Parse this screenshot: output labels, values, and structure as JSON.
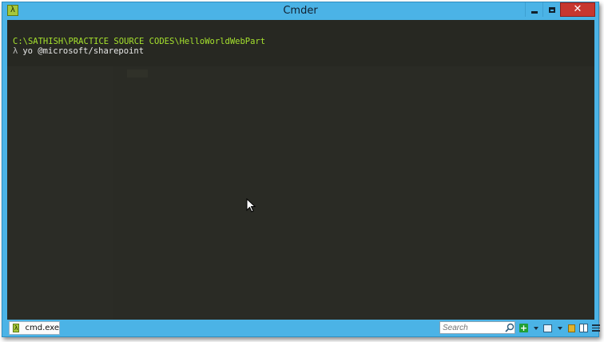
{
  "window": {
    "title": "Cmder",
    "app_icon_glyph": "λ",
    "close_glyph": "✕"
  },
  "console": {
    "path_line": "C:\\SATHISH\\PRACTICE SOURCE CODES\\HelloWorldWebPart",
    "prompt_symbol": "λ",
    "command": "yo @microsoft/sharepoint"
  },
  "statusbar": {
    "tab_icon_glyph": "λ",
    "tab_label": "cmd.exe",
    "search_placeholder": "Search",
    "new_console_glyph": "+"
  },
  "colors": {
    "console_bg": "#272822",
    "path_text": "#a6e22e",
    "chrome": "#4bb3e6",
    "close_button": "#c7372f"
  },
  "icons": [
    "lambda-app-icon",
    "minimize-icon",
    "maximize-icon",
    "close-icon",
    "mouse-pointer-icon",
    "search-icon",
    "plus-icon",
    "layout-icon",
    "lock-icon",
    "split-pane-icon",
    "menu-icon"
  ]
}
